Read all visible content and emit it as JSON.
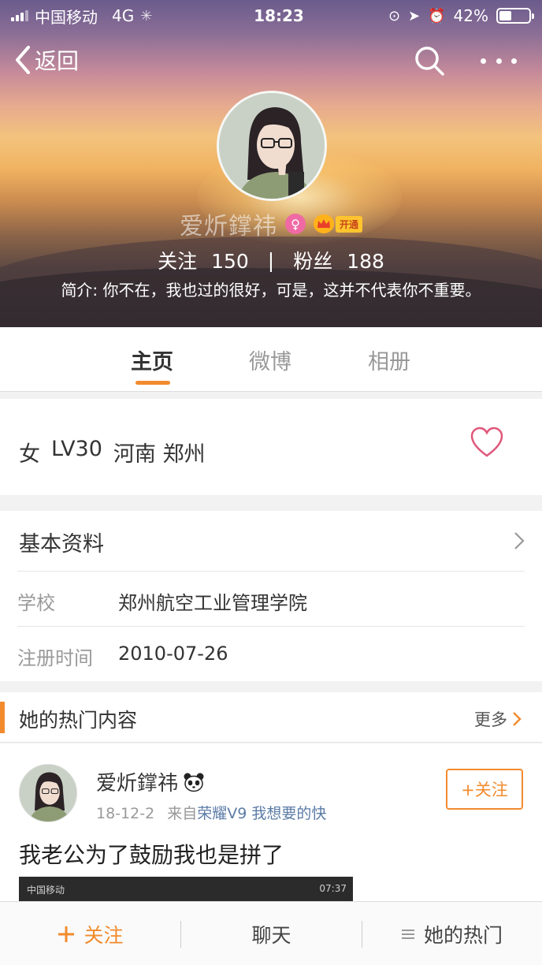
{
  "status_bar": {
    "carrier": "中国移动",
    "network": "4G",
    "time": "18:23",
    "battery": "42%",
    "battery_level": 0.42
  },
  "nav": {
    "back_label": "返回"
  },
  "profile": {
    "name": "爱炘鐣祎",
    "vip_label": "开通",
    "following_label": "关注",
    "following_count": "150",
    "followers_label": "粉丝",
    "followers_count": "188",
    "bio": "简介: 你不在，我也过的很好，可是，这并不代表你不重要。"
  },
  "tabs": [
    {
      "label": "主页",
      "active": true
    },
    {
      "label": "微博",
      "active": false
    },
    {
      "label": "相册",
      "active": false
    }
  ],
  "info": {
    "gender": "女",
    "level": "LV30",
    "location": "河南 郑州"
  },
  "basic": {
    "title": "基本资料",
    "rows": [
      {
        "key": "学校",
        "value": "郑州航空工业管理学院"
      },
      {
        "key": "注册时间",
        "value": "2010-07-26"
      }
    ]
  },
  "hot": {
    "title": "她的热门内容",
    "more_label": "更多"
  },
  "post": {
    "author": "爱炘鐣祎",
    "date": "18-12-2",
    "from_label": "来自",
    "source": "荣耀V9 我想要的快",
    "follow_label": "+关注",
    "text": "我老公为了鼓励我也是拼了",
    "image_status_left": "中国移动",
    "image_status_right": "07:37"
  },
  "bottom_bar": {
    "follow_label": "关注",
    "chat_label": "聊天",
    "hot_label": "她的热门"
  },
  "colors": {
    "accent": "#f28b2e",
    "link": "#5b7ba6",
    "heart": "#e0577a"
  }
}
